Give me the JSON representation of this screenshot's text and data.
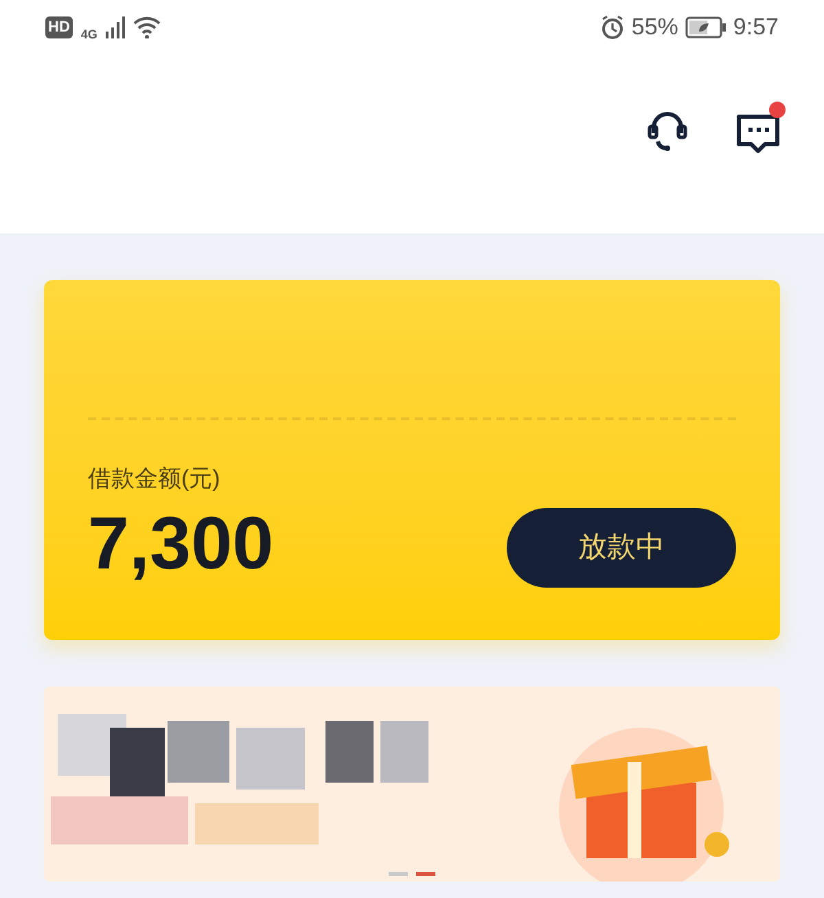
{
  "status_bar": {
    "hd": "HD",
    "network": "4G",
    "battery": "55%",
    "time": "9:57"
  },
  "header": {
    "message_unread": true
  },
  "loan_card": {
    "label": "借款金额(元)",
    "amount": "7,300",
    "status_button": "放款中"
  },
  "banner": {
    "kind": "picture",
    "dots": [
      {
        "selected": false
      },
      {
        "selected": true
      }
    ]
  }
}
